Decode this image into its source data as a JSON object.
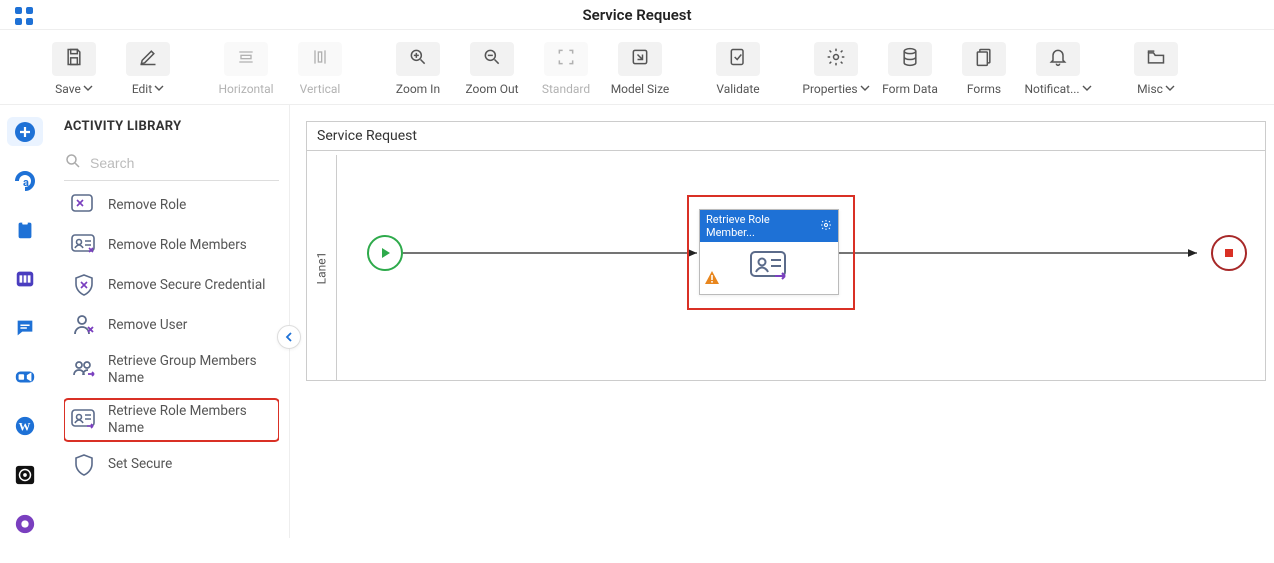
{
  "header": {
    "title": "Service Request"
  },
  "toolbar": {
    "save": "Save",
    "edit": "Edit",
    "horizontal": "Horizontal",
    "vertical": "Vertical",
    "zoom_in": "Zoom In",
    "zoom_out": "Zoom Out",
    "standard": "Standard",
    "model_size": "Model Size",
    "validate": "Validate",
    "properties": "Properties",
    "form_data": "Form Data",
    "forms": "Forms",
    "notifications": "Notificat...",
    "misc": "Misc"
  },
  "library": {
    "title": "ACTIVITY LIBRARY",
    "search_placeholder": "Search",
    "items": {
      "remove_role": "Remove Role",
      "remove_role_members": "Remove Role Members",
      "remove_secure_credential": "Remove Secure Credential",
      "remove_user": "Remove User",
      "retrieve_group_members_name": "Retrieve Group Members Name",
      "retrieve_role_members_name": "Retrieve Role Members Name",
      "set_secure": "Set Secure"
    }
  },
  "canvas": {
    "title": "Service Request",
    "lane_label": "Lane1",
    "activity_title": "Retrieve Role Member..."
  },
  "left_rail": {
    "add": "add",
    "a": "a",
    "clipboard": "clipboard",
    "columns": "columns",
    "chat": "chat",
    "video": "video",
    "wordpress": "wordpress",
    "target": "target",
    "support": "support"
  }
}
